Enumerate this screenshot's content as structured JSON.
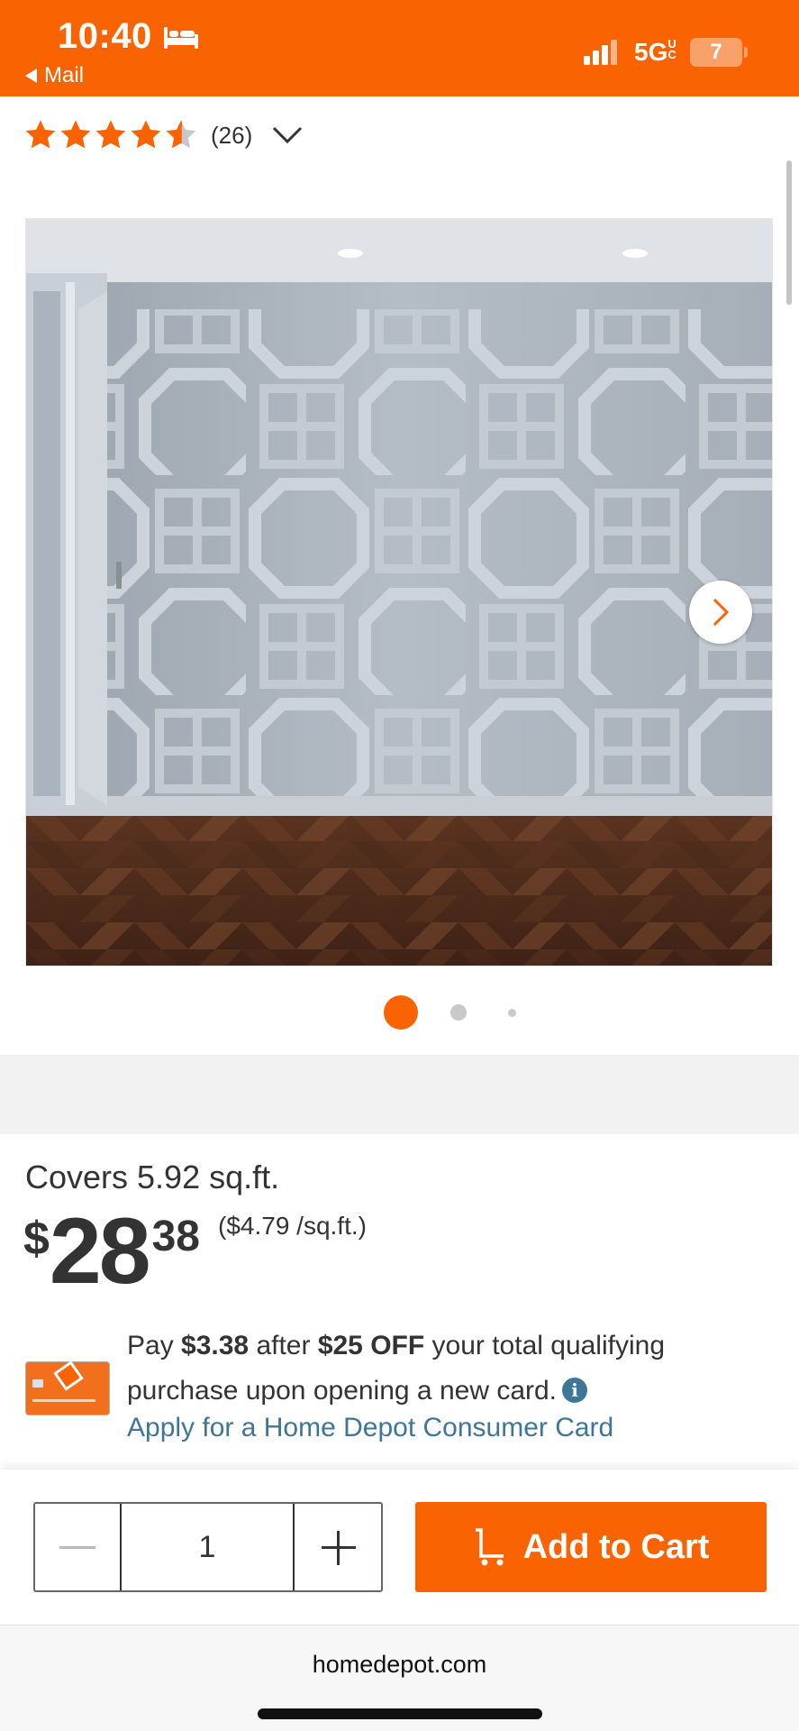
{
  "status_bar": {
    "time": "10:40",
    "back_app": "Mail",
    "network": "5G",
    "network_suffix": "UC",
    "battery": "7",
    "colors": {
      "background": "#f96302"
    }
  },
  "rating": {
    "stars": 4.5,
    "max_stars": 5,
    "count": "(26)",
    "icons": [
      "star-icon",
      "chevron-down-icon"
    ]
  },
  "gallery": {
    "image_count": 3,
    "active_index": 0,
    "icons": [
      "chevron-right-icon"
    ]
  },
  "pricing": {
    "coverage": "Covers 5.92 sq.ft.",
    "currency": "$",
    "dollars": "28",
    "cents": "38",
    "unit_price": "($4.79 /sq.ft.)"
  },
  "promo": {
    "line_prefix": "Pay ",
    "pay_amount": "$3.38",
    "mid": " after ",
    "discount": "$25 OFF",
    "line_suffix": " your total qualifying purchase upon opening a new card.",
    "apply_link": "Apply for a Home Depot Consumer Card",
    "icons": [
      "credit-card-icon",
      "info-icon"
    ]
  },
  "purchase": {
    "quantity": "1",
    "add_to_cart": "Add to Cart",
    "colors": {
      "button": "#f96302"
    }
  },
  "browser": {
    "url": "homedepot.com"
  }
}
